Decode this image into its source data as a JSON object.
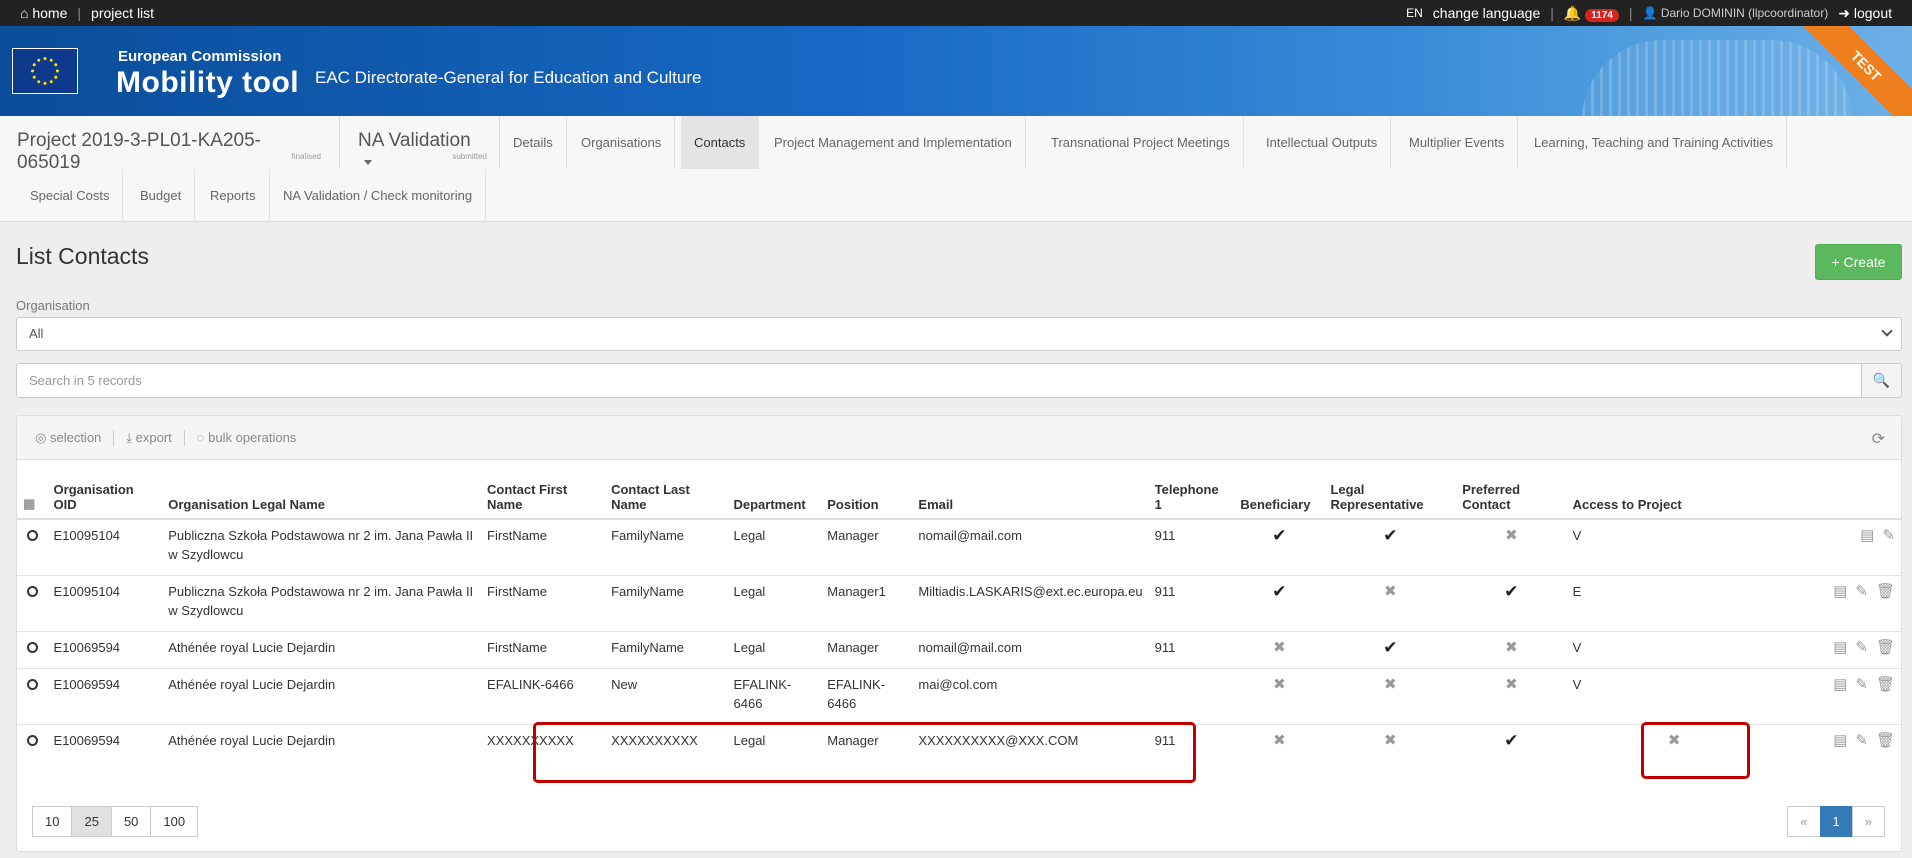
{
  "topbar": {
    "home": "home",
    "project_list": "project list",
    "lang": "EN",
    "change_language": "change language",
    "notif_count": "1174",
    "user": "Dario DOMININ (llpcoordinator)",
    "logout": "logout"
  },
  "banner": {
    "ec": "European Commission",
    "tool": "Mobility tool",
    "dg": "EAC Directorate-General for Education and Culture",
    "ribbon": "TEST"
  },
  "project": {
    "title": "Project 2019-3-PL01-KA205-065019",
    "status": "finalised",
    "nav": "NA Validation",
    "nav_status": "submitted"
  },
  "tabs": [
    "Details",
    "Organisations",
    "Contacts",
    "Project Management and Implementation",
    "Transnational Project Meetings",
    "Intellectual Outputs",
    "Multiplier Events",
    "Learning, Teaching and Training Activities",
    "Special Costs",
    "Budget",
    "Reports",
    "NA Validation / Check monitoring"
  ],
  "page": {
    "title": "List Contacts",
    "create": "Create",
    "org_label": "Organisation",
    "org_value": "All",
    "search_placeholder": "Search in 5 records"
  },
  "toolbar": {
    "selection": "selection",
    "export": "export",
    "bulk": "bulk operations"
  },
  "columns": [
    "Organisation OID",
    "Organisation Legal Name",
    "Contact First Name",
    "Contact Last Name",
    "Department",
    "Position",
    "Email",
    "Telephone 1",
    "Beneficiary",
    "Legal Representative",
    "Preferred Contact",
    "Access to Project"
  ],
  "rows": [
    {
      "oid": "E10095104",
      "org": "Publiczna Szkoła Podstawowa nr 2 im. Jana Pawła II w Szydlowcu",
      "first": "FirstName",
      "last": "FamilyName",
      "dept": "Legal",
      "pos": "Manager",
      "email": "nomail@mail.com",
      "tel": "911",
      "ben": true,
      "legal": true,
      "pref": false,
      "access": "V",
      "del": false
    },
    {
      "oid": "E10095104",
      "org": "Publiczna Szkoła Podstawowa nr 2 im. Jana Pawła II w Szydlowcu",
      "first": "FirstName",
      "last": "FamilyName",
      "dept": "Legal",
      "pos": "Manager1",
      "email": "Miltiadis.LASKARIS@ext.ec.europa.eu",
      "tel": "911",
      "ben": true,
      "legal": false,
      "pref": true,
      "access": "E",
      "del": true
    },
    {
      "oid": "E10069594",
      "org": "Athénée royal Lucie Dejardin",
      "first": "FirstName",
      "last": "FamilyName",
      "dept": "Legal",
      "pos": "Manager",
      "email": "nomail@mail.com",
      "tel": "911",
      "ben": false,
      "legal": true,
      "pref": false,
      "access": "V",
      "del": true
    },
    {
      "oid": "E10069594",
      "org": "Athénée royal Lucie Dejardin",
      "first": "EFALINK-6466",
      "last": "New",
      "dept": "EFALINK-6466",
      "pos": "EFALINK-6466",
      "email": "mai@col.com",
      "tel": "",
      "ben": false,
      "legal": false,
      "pref": false,
      "access": "V",
      "del": true
    },
    {
      "oid": "E10069594",
      "org": "Athénée royal Lucie Dejardin",
      "first": "XXXXXXXXXX",
      "last": "XXXXXXXXXX",
      "dept": "Legal",
      "pos": "Manager",
      "email": "XXXXXXXXXX@XXX.COM",
      "tel": "911",
      "ben": false,
      "legal": false,
      "pref": true,
      "access": "",
      "access_x": true,
      "del": true
    }
  ],
  "page_sizes": [
    "10",
    "25",
    "50",
    "100"
  ],
  "active_size": "25",
  "pager": {
    "prev": "«",
    "current": "1",
    "next": "»"
  }
}
